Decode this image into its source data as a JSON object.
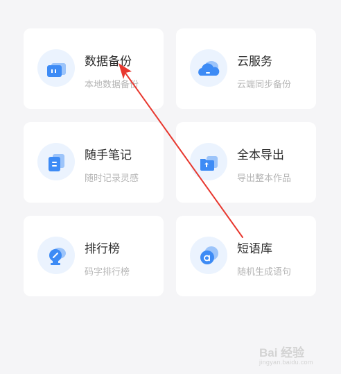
{
  "cards": [
    {
      "title": "数据备份",
      "subtitle": "本地数据备份",
      "icon": "backup-icon"
    },
    {
      "title": "云服务",
      "subtitle": "云端同步备份",
      "icon": "cloud-icon"
    },
    {
      "title": "随手笔记",
      "subtitle": "随时记录灵感",
      "icon": "note-icon"
    },
    {
      "title": "全本导出",
      "subtitle": "导出整本作品",
      "icon": "export-folder-icon"
    },
    {
      "title": "排行榜",
      "subtitle": "码字排行榜",
      "icon": "ranking-trophy-icon"
    },
    {
      "title": "短语库",
      "subtitle": "随机生成语句",
      "icon": "phrase-library-icon"
    }
  ],
  "watermark": {
    "top": "Bai 经验",
    "bottom": "jingyan.baidu.com"
  },
  "colors": {
    "accent": "#3d8bf5",
    "accent_light": "#9cc4fa",
    "icon_bg": "#ebf3fe",
    "annotation_arrow": "#e8382f"
  }
}
